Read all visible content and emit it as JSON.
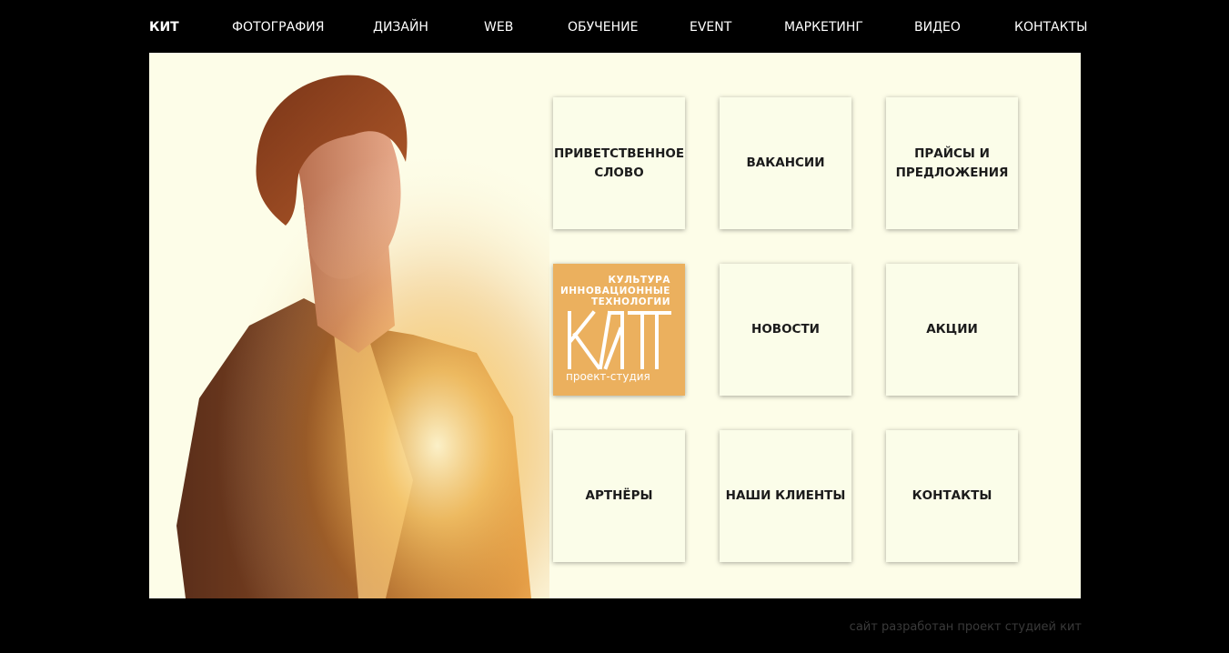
{
  "nav": {
    "items": [
      {
        "label": "КИТ"
      },
      {
        "label": "ФОТОГРАФИЯ"
      },
      {
        "label": "ДИЗАЙН"
      },
      {
        "label": "WEB"
      },
      {
        "label": "ОБУЧЕНИЕ"
      },
      {
        "label": "EVENT"
      },
      {
        "label": "МАРКЕТИНГ"
      },
      {
        "label": "ВИДЕО"
      },
      {
        "label": "КОНТАКТЫ"
      }
    ]
  },
  "tiles": [
    {
      "label": "ПРИВЕТСТВЕННОЕ СЛОВО"
    },
    {
      "label": "ВАКАНСИИ"
    },
    {
      "label": "ПРАЙСЫ И ПРЕДЛОЖЕНИЯ"
    },
    {
      "label": "НОВОСТИ"
    },
    {
      "label": "АКЦИИ"
    },
    {
      "label": "АРТНЁРЫ"
    },
    {
      "label": "НАШИ КЛИЕНТЫ"
    },
    {
      "label": "КОНТАКТЫ"
    }
  ],
  "logo": {
    "line1": "КУЛЬТУРА",
    "line2": "ИННОВАЦИОННЫЕ",
    "line3": "ТЕХНОЛОГИИ",
    "mark": "КИТ",
    "subtitle": "проект-студия"
  },
  "footer": {
    "text": "сайт разработан проект студией кит"
  },
  "colors": {
    "page_background": "#000000",
    "stage_background": "#fdfde8",
    "tile_background": "#fbfde9",
    "logo_tile": "#ebb05e",
    "footer_text": "#3a3a3a"
  }
}
